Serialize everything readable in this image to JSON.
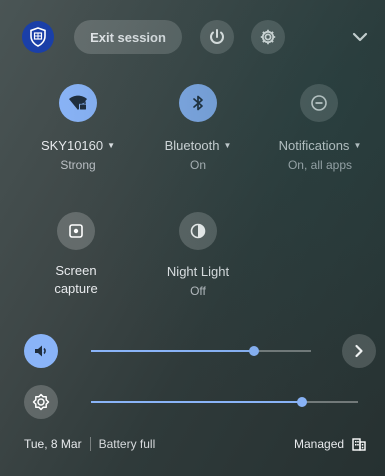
{
  "header": {
    "exit_label": "Exit session"
  },
  "tiles": [
    {
      "label": "SKY10160",
      "sub": "Strong",
      "has_menu": true
    },
    {
      "label": "Bluetooth",
      "sub": "On",
      "has_menu": true
    },
    {
      "label": "Notifications",
      "sub": "On, all apps",
      "has_menu": true
    },
    {
      "label": "Screen",
      "label2": "capture",
      "sub": ""
    },
    {
      "label": "Night Light",
      "sub": "Off"
    }
  ],
  "sliders": {
    "volume_level": 0.74,
    "brightness_level": 0.79
  },
  "footer": {
    "date": "Tue, 8 Mar",
    "battery": "Battery full",
    "managed": "Managed"
  },
  "colors": {
    "accent": "#8ab4f8",
    "avatar_bg": "#1a3fa8"
  },
  "icons": {
    "avatar": "shield-icon",
    "power": "power-icon",
    "settings": "gear-icon",
    "collapse": "chevron-down-icon",
    "wifi": "wifi-locked-icon",
    "bluetooth": "bluetooth-icon",
    "notifications": "do-not-disturb-icon",
    "screen_capture": "screen-capture-icon",
    "night_light": "night-light-icon",
    "volume": "volume-icon",
    "audio_settings": "chevron-right-icon",
    "brightness": "brightness-icon",
    "managed": "building-icon"
  }
}
